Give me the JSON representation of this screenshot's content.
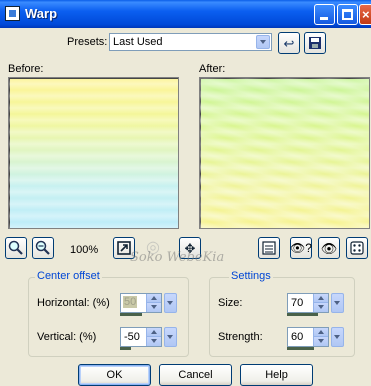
{
  "window": {
    "title": "Warp"
  },
  "presets": {
    "label": "Presets:",
    "value": "Last Used"
  },
  "preview": {
    "before_label": "Before:",
    "after_label": "After:",
    "zoom": "100%"
  },
  "center_offset": {
    "title": "Center offset",
    "horizontal_label": "Horizontal: (%)",
    "horizontal_value": "50",
    "vertical_label": "Vertical: (%)",
    "vertical_value": "-50"
  },
  "settings": {
    "title": "Settings",
    "size_label": "Size:",
    "size_value": "70",
    "strength_label": "Strength:",
    "strength_value": "60"
  },
  "buttons": {
    "ok": "OK",
    "cancel": "Cancel",
    "help": "Help"
  },
  "watermark": "Soko WebeKia",
  "icons": [
    "app-icon",
    "minimize-icon",
    "maximize-icon",
    "close-icon",
    "reset-preset-icon",
    "save-preset-icon",
    "zoom-in-icon",
    "zoom-out-icon",
    "zoom-to-fit-icon",
    "proof-icon",
    "move-icon",
    "toggle-preview-icon",
    "randomize-icon",
    "eye-icon",
    "dice-icon"
  ],
  "colors": {
    "titlebar": "#0b5ff0",
    "group_title": "#0046d5",
    "dialog_bg": "#ece9d8"
  }
}
